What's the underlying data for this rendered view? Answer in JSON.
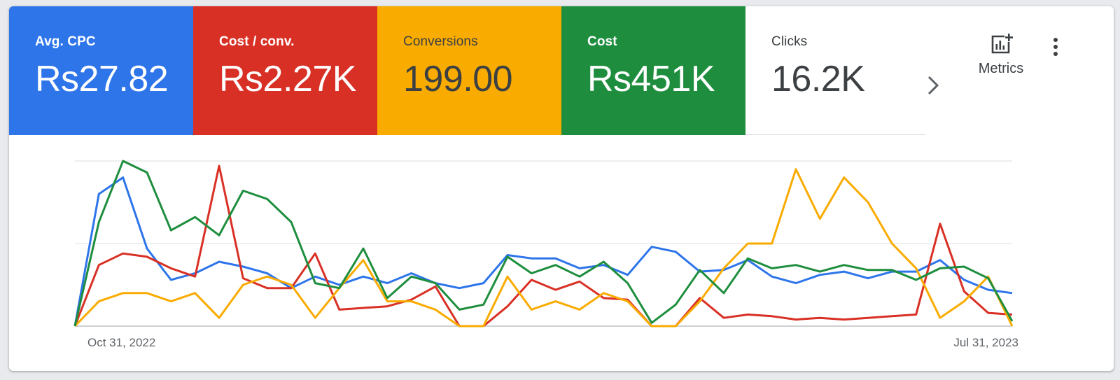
{
  "scorecards": [
    {
      "label": "Avg. CPC",
      "value": "Rs27.82",
      "color": "#2e75ea"
    },
    {
      "label": "Cost / conv.",
      "value": "Rs2.27K",
      "color": "#d93025"
    },
    {
      "label": "Conversions",
      "value": "199.00",
      "color": "#f9ab00"
    },
    {
      "label": "Cost",
      "value": "Rs451K",
      "color": "#1e8e3e"
    },
    {
      "label": "Clicks",
      "value": "16.2K",
      "color": "#ffffff"
    }
  ],
  "toolbar": {
    "next_icon": "chevron-right-icon",
    "metrics_label": "Metrics",
    "metrics_icon": "add-chart-icon",
    "more_icon": "more-vert-icon"
  },
  "chart_data": {
    "type": "line",
    "x_start_label": "Oct 31, 2022",
    "x_end_label": "Jul 31, 2023",
    "grid": true,
    "ylim": [
      0,
      100
    ],
    "series": [
      {
        "color": "#2e75ea",
        "values": [
          0,
          80,
          90,
          47,
          28,
          32,
          39,
          36,
          32,
          23,
          30,
          25,
          30,
          26,
          32,
          26,
          23,
          26,
          43,
          41,
          41,
          35,
          37,
          31,
          48,
          45,
          33,
          34,
          40,
          30,
          26,
          31,
          33,
          29,
          33,
          33,
          40,
          28,
          22,
          20
        ]
      },
      {
        "color": "#d93025",
        "values": [
          0,
          37,
          44,
          42,
          35,
          30,
          97,
          29,
          23,
          23,
          44,
          10,
          11,
          12,
          16,
          24,
          0,
          0,
          12,
          28,
          22,
          27,
          17,
          16,
          0,
          0,
          17,
          5,
          7,
          6,
          4,
          5,
          4,
          5,
          6,
          7,
          62,
          21,
          8,
          7
        ]
      },
      {
        "color": "#f9ab00",
        "values": [
          0,
          15,
          20,
          20,
          15,
          20,
          5,
          25,
          30,
          25,
          5,
          23,
          40,
          15,
          15,
          10,
          0,
          0,
          30,
          10,
          15,
          10,
          20,
          15,
          0,
          0,
          15,
          35,
          50,
          50,
          95,
          65,
          90,
          75,
          50,
          35,
          5,
          15,
          30,
          0
        ]
      },
      {
        "color": "#1e8e3e",
        "values": [
          0,
          63,
          100,
          93,
          58,
          66,
          55,
          82,
          77,
          63,
          26,
          23,
          47,
          17,
          30,
          26,
          10,
          13,
          42,
          32,
          37,
          30,
          39,
          26,
          2,
          13,
          34,
          20,
          41,
          35,
          37,
          33,
          37,
          34,
          34,
          28,
          35,
          36,
          29,
          3
        ]
      }
    ]
  }
}
